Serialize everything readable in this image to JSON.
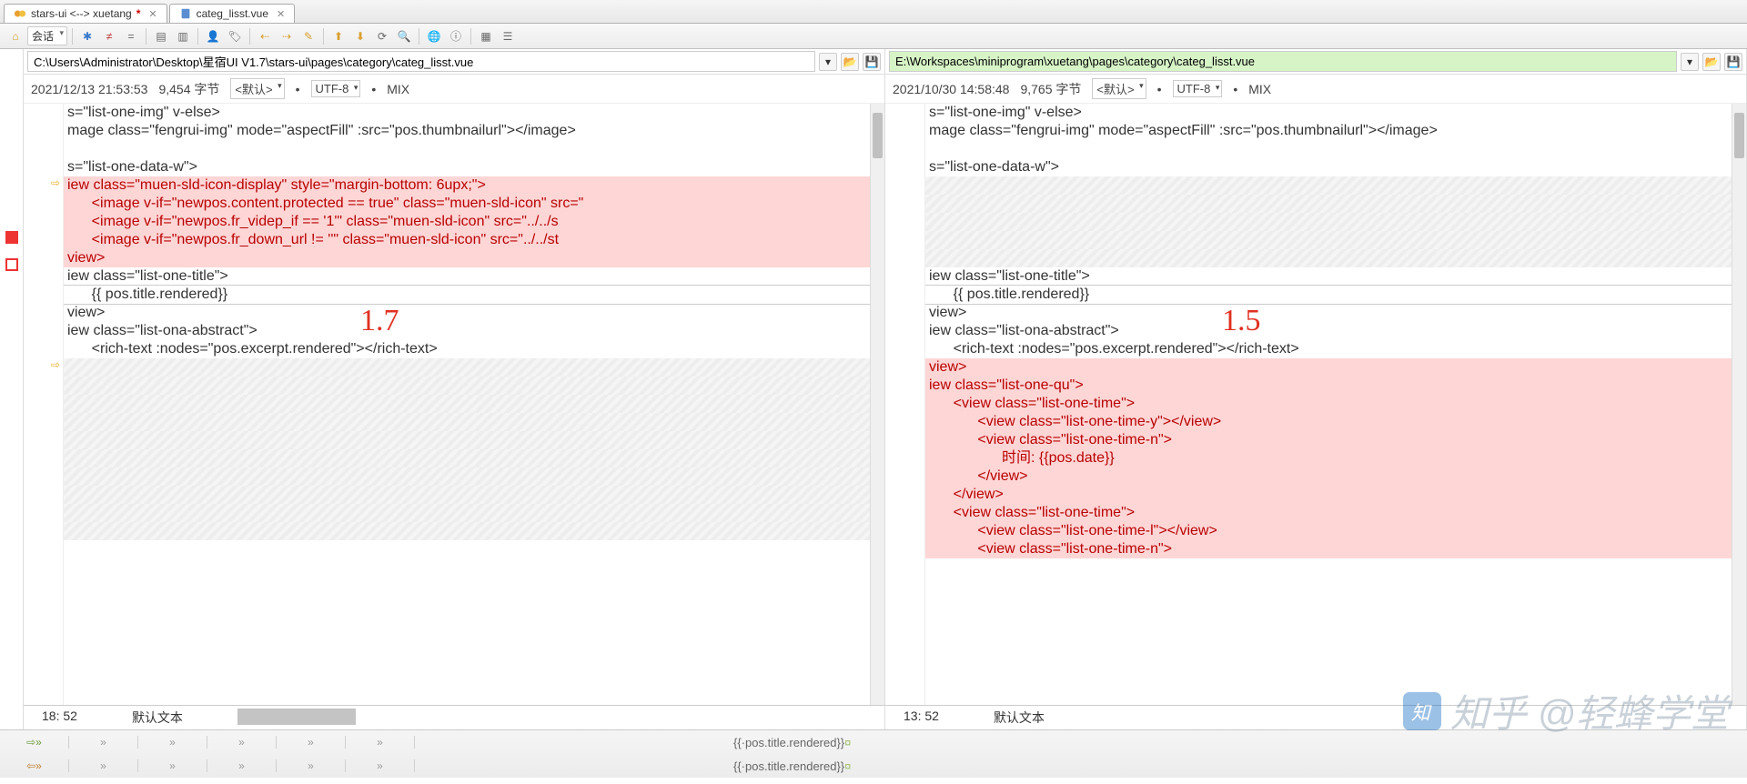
{
  "tabs": [
    {
      "label": "stars-ui <--> xuetang",
      "dirty": true,
      "icon": "diff"
    },
    {
      "label": "categ_lisst.vue",
      "dirty": false,
      "icon": "file"
    }
  ],
  "toolbar": {
    "home": "⌂",
    "session": "会话"
  },
  "left": {
    "path": "C:\\Users\\Administrator\\Desktop\\星宿UI V1.7\\stars-ui\\pages\\category\\categ_lisst.vue",
    "date": "2021/12/13 21:53:53",
    "bytes": "9,454 字节",
    "enc_sel": "<默认>",
    "enc": "UTF-8",
    "bom": "MIX",
    "overlay": "1.7",
    "status_pos": "18: 52",
    "status_mode": "默认文本",
    "lines": [
      {
        "t": "s=\"list-one-img\" v-else>",
        "c": "blk"
      },
      {
        "t": "mage class=\"fengrui-img\" mode=\"aspectFill\" :src=\"pos.thumbnailurl\"></image>",
        "c": "blk"
      },
      {
        "t": "",
        "c": "blk"
      },
      {
        "t": "s=\"list-one-data-w\">",
        "c": "blk"
      },
      {
        "t": "iew class=\"muen-sld-icon-display\" style=\"margin-bottom: 6upx;\">",
        "c": "red",
        "bg": "pink"
      },
      {
        "t": "      <image v-if=\"newpos.content.protected == true\" class=\"muen-sld-icon\" src=\"",
        "c": "red",
        "bg": "pink"
      },
      {
        "t": "      <image v-if=\"newpos.fr_videp_if == '1'\" class=\"muen-sld-icon\" src=\"../../s",
        "c": "red",
        "bg": "pink"
      },
      {
        "t": "      <image v-if=\"newpos.fr_down_url != ''\" class=\"muen-sld-icon\" src=\"../../st",
        "c": "red",
        "bg": "pink"
      },
      {
        "t": "view>",
        "c": "red",
        "bg": "pink"
      },
      {
        "t": "iew class=\"list-one-title\">",
        "c": "blk"
      },
      {
        "t": "      {{ pos.title.rendered}}",
        "c": "blk",
        "boxed": true
      },
      {
        "t": "view>",
        "c": "blk"
      },
      {
        "t": "iew class=\"list-ona-abstract\">",
        "c": "blk"
      },
      {
        "t": "      <rich-text :nodes=\"pos.excerpt.rendered\"></rich-text>",
        "c": "blk"
      },
      {
        "t": "",
        "c": "blk",
        "bg": "hatch"
      },
      {
        "t": "",
        "c": "blk",
        "bg": "hatch"
      },
      {
        "t": "",
        "c": "blk",
        "bg": "hatch"
      },
      {
        "t": "",
        "c": "blk",
        "bg": "hatch"
      },
      {
        "t": "",
        "c": "blk",
        "bg": "hatch"
      },
      {
        "t": "",
        "c": "blk",
        "bg": "hatch"
      },
      {
        "t": "",
        "c": "blk",
        "bg": "hatch"
      },
      {
        "t": "",
        "c": "blk",
        "bg": "hatch"
      },
      {
        "t": "",
        "c": "blk",
        "bg": "hatch"
      },
      {
        "t": "",
        "c": "blk",
        "bg": "hatch"
      }
    ]
  },
  "right": {
    "path": "E:\\Workspaces\\miniprogram\\xuetang\\pages\\category\\categ_lisst.vue",
    "date": "2021/10/30 14:58:48",
    "bytes": "9,765 字节",
    "enc_sel": "<默认>",
    "enc": "UTF-8",
    "bom": "MIX",
    "overlay": "1.5",
    "status_pos": "13: 52",
    "status_mode": "默认文本",
    "lines": [
      {
        "t": "s=\"list-one-img\" v-else>",
        "c": "blk"
      },
      {
        "t": "mage class=\"fengrui-img\" mode=\"aspectFill\" :src=\"pos.thumbnailurl\"></image>",
        "c": "blk"
      },
      {
        "t": "",
        "c": "blk"
      },
      {
        "t": "s=\"list-one-data-w\">",
        "c": "blk"
      },
      {
        "t": "",
        "c": "blk",
        "bg": "hatch"
      },
      {
        "t": "",
        "c": "blk",
        "bg": "hatch"
      },
      {
        "t": "",
        "c": "blk",
        "bg": "hatch"
      },
      {
        "t": "",
        "c": "blk",
        "bg": "hatch"
      },
      {
        "t": "",
        "c": "blk",
        "bg": "hatch"
      },
      {
        "t": "iew class=\"list-one-title\">",
        "c": "blk"
      },
      {
        "t": "      {{ pos.title.rendered}}",
        "c": "blk",
        "boxed": true
      },
      {
        "t": "view>",
        "c": "blk"
      },
      {
        "t": "iew class=\"list-ona-abstract\">",
        "c": "blk"
      },
      {
        "t": "      <rich-text :nodes=\"pos.excerpt.rendered\"></rich-text>",
        "c": "blk"
      },
      {
        "t": "view>",
        "c": "red",
        "bg": "pink"
      },
      {
        "t": "iew class=\"list-one-qu\">",
        "c": "red",
        "bg": "pink"
      },
      {
        "t": "      <view class=\"list-one-time\">",
        "c": "red",
        "bg": "pink"
      },
      {
        "t": "            <view class=\"list-one-time-y\"></view>",
        "c": "red",
        "bg": "pink"
      },
      {
        "t": "            <view class=\"list-one-time-n\">",
        "c": "red",
        "bg": "pink"
      },
      {
        "t": "                  时间: {{pos.date}}",
        "c": "red",
        "bg": "pink"
      },
      {
        "t": "            </view>",
        "c": "red",
        "bg": "pink"
      },
      {
        "t": "      </view>",
        "c": "red",
        "bg": "pink"
      },
      {
        "t": "      <view class=\"list-one-time\">",
        "c": "red",
        "bg": "pink"
      },
      {
        "t": "            <view class=\"list-one-time-l\"></view>",
        "c": "red",
        "bg": "pink"
      },
      {
        "t": "            <view class=\"list-one-time-n\">",
        "c": "red",
        "bg": "pink"
      }
    ]
  },
  "bottom": {
    "text_a": "{{·pos.title.rendered}}",
    "text_b": "{{·pos.title.rendered}}",
    "arrows": "»"
  },
  "watermark": "知乎 @轻蜂学堂"
}
